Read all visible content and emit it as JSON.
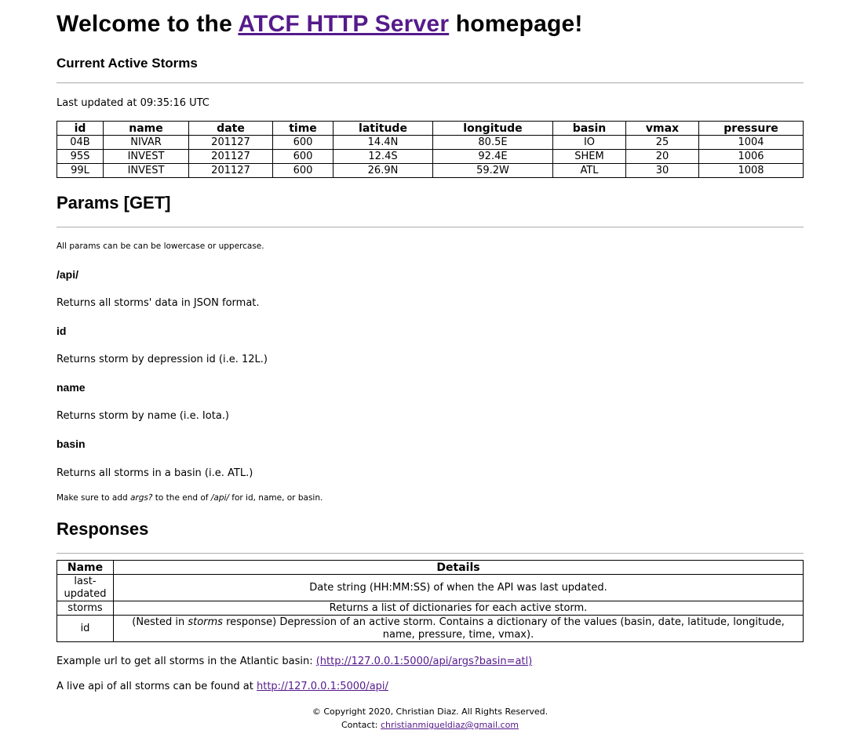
{
  "header": {
    "title_prefix": "Welcome to the ",
    "title_link": "ATCF HTTP Server",
    "title_suffix": " homepage!"
  },
  "storms": {
    "heading": "Current Active Storms",
    "last_updated": "Last updated at 09:35:16 UTC",
    "columns": [
      "id",
      "name",
      "date",
      "time",
      "latitude",
      "longitude",
      "basin",
      "vmax",
      "pressure"
    ],
    "rows": [
      [
        "04B",
        "NIVAR",
        "201127",
        "600",
        "14.4N",
        "80.5E",
        "IO",
        "25",
        "1004"
      ],
      [
        "95S",
        "INVEST",
        "201127",
        "600",
        "12.4S",
        "92.4E",
        "SHEM",
        "20",
        "1006"
      ],
      [
        "99L",
        "INVEST",
        "201127",
        "600",
        "26.9N",
        "59.2W",
        "ATL",
        "30",
        "1008"
      ]
    ]
  },
  "params": {
    "heading": "Params [GET]",
    "note": "All params can be can be lowercase or uppercase.",
    "items": [
      {
        "name": "/api/",
        "desc": "Returns all storms' data in JSON format."
      },
      {
        "name": "id",
        "desc": "Returns storm by depression id (i.e. 12L.)"
      },
      {
        "name": "name",
        "desc": "Returns storm by name (i.e. Iota.)"
      },
      {
        "name": "basin",
        "desc": "Returns all storms in a basin (i.e. ATL.)"
      }
    ],
    "hint_1": "Make sure to add ",
    "hint_args": "args?",
    "hint_2": " to the end of ",
    "hint_api": "/api/",
    "hint_3": " for id, name, or basin."
  },
  "responses": {
    "heading": "Responses",
    "columns": [
      "Name",
      "Details"
    ],
    "rows": [
      {
        "name": "last-updated",
        "details": "Date string (HH:MM:SS) of when the API was last updated."
      },
      {
        "name": "storms",
        "details": "Returns a list of dictionaries for each active storm."
      },
      {
        "name": "id",
        "details_pre": "(Nested in ",
        "details_em": "storms",
        "details_post": " response) Depression of an active storm. Contains a dictionary of the values (basin, date, latitude, longitude, name, pressure, time, vmax)."
      }
    ]
  },
  "example": {
    "text": "Example url to get all storms in the Atlantic basin: ",
    "link": "(http://127.0.0.1:5000/api/args?basin=atl)"
  },
  "live": {
    "text": "A live api of all storms can be found at ",
    "link": "http://127.0.0.1:5000/api/"
  },
  "footer": {
    "copyright": "© Copyright 2020, Christian Diaz. All Rights Reserved.",
    "contact_label": "Contact: ",
    "contact_email": "christianmigueldiaz@gmail.com"
  },
  "colors": {
    "link": "#551a8b"
  }
}
